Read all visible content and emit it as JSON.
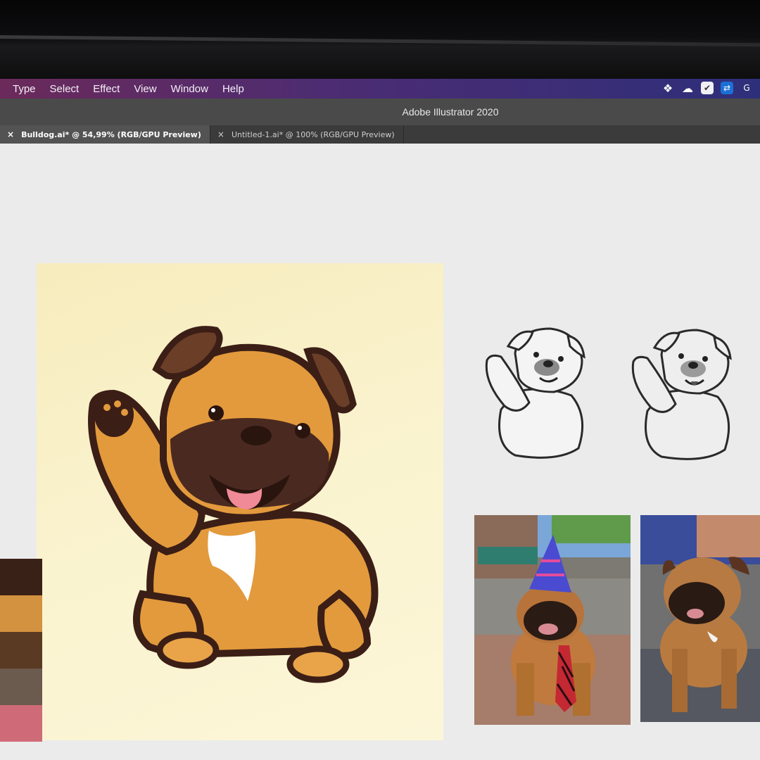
{
  "menu": [
    "Type",
    "Select",
    "Effect",
    "View",
    "Window",
    "Help"
  ],
  "window_title": "Adobe Illustrator 2020",
  "tabs": [
    {
      "label": "Bulldog.ai* @ 54,99% (RGB/GPU Preview)",
      "close": "×",
      "active": true
    },
    {
      "label": "Untitled-1.ai* @ 100% (RGB/GPU Preview)",
      "close": "×",
      "active": false
    }
  ],
  "tray_icons": [
    "dropbox-icon",
    "creative-cloud-icon",
    "check-icon",
    "teamviewer-icon",
    "g-icon"
  ],
  "tray_glyphs": [
    "❖",
    "☁",
    "✔",
    "⇄",
    "G"
  ],
  "swatch_colors": [
    "#3a2118",
    "#d2923f",
    "#5a3a22",
    "#6b5a4e",
    "#cf6b78"
  ],
  "colors": {
    "menubar_start": "#6b2a5a",
    "menubar_end": "#2e2f7a",
    "artboard": "#f9f0c8",
    "dog_fur": "#e39a3c",
    "dog_outline": "#3b1e16",
    "dog_muzzle": "#4a2a20",
    "tongue": "#f08a96"
  }
}
